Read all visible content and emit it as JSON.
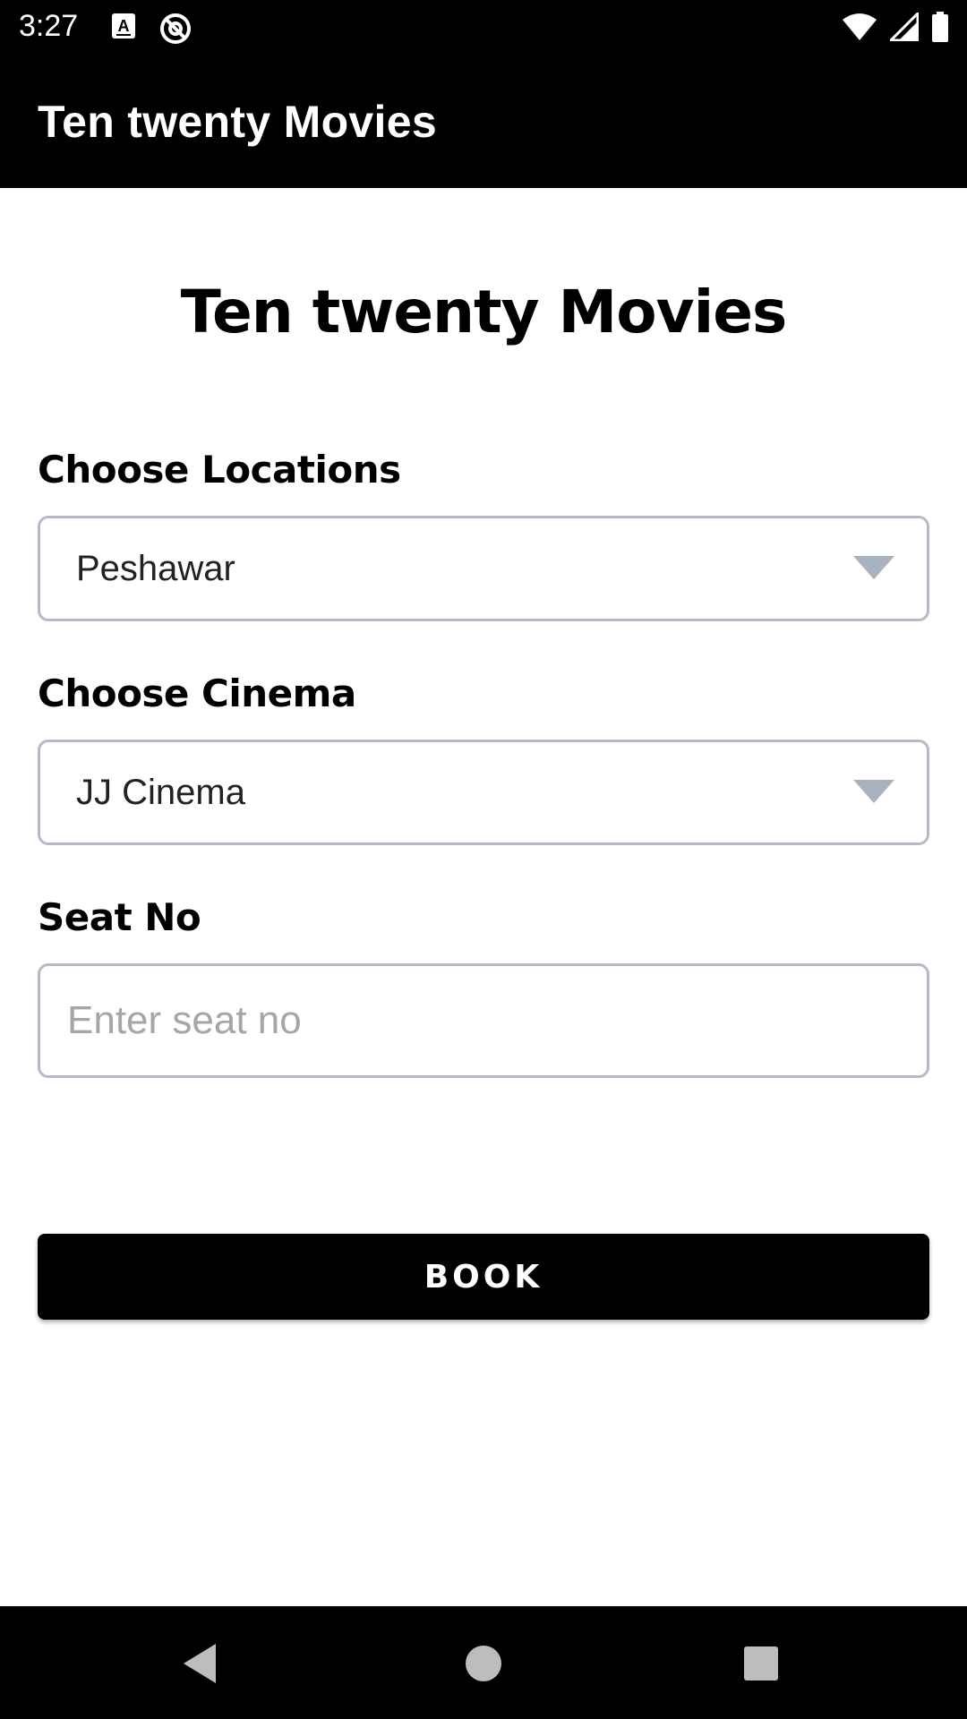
{
  "status_bar": {
    "time": "3:27",
    "left_icons": [
      "a-keyboard-icon",
      "at-sign-icon"
    ],
    "right_icons": [
      "wifi-icon",
      "signal-icon",
      "battery-icon"
    ]
  },
  "app_bar": {
    "title": "Ten twenty Movies"
  },
  "form": {
    "heading": "Ten twenty Movies",
    "location": {
      "label": "Choose Locations",
      "value": "Peshawar"
    },
    "cinema": {
      "label": "Choose Cinema",
      "value": "JJ Cinema"
    },
    "seat": {
      "label": "Seat No",
      "placeholder": "Enter seat no",
      "value": ""
    },
    "book_label": "BOOK"
  },
  "nav_bar": {
    "buttons": [
      "back-icon",
      "home-icon",
      "recents-icon"
    ]
  },
  "colors": {
    "bar_background": "#000000",
    "field_border": "#b3bac6",
    "caret": "#a9b2bf",
    "placeholder": "#a6a6a6"
  }
}
